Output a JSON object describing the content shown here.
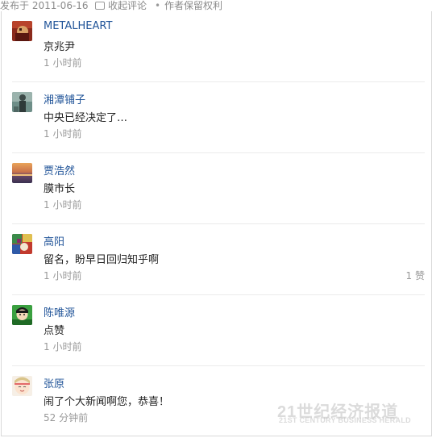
{
  "article_meta": {
    "published": "发布于 2011-06-16",
    "collapse_comments": "收起评论",
    "separator": "•",
    "copyright": "作者保留权利"
  },
  "comments": [
    {
      "author": "METALHEART",
      "text": "京兆尹",
      "time": "1 小时前",
      "likes": "",
      "avatar": "avatar-red-abstract"
    },
    {
      "author": "湘潭铺子",
      "text": "中央已经决定了…",
      "time": "1 小时前",
      "likes": "",
      "avatar": "avatar-figure-teal"
    },
    {
      "author": "贾浩然",
      "text": "膜市长",
      "time": "1 小时前",
      "likes": "",
      "avatar": "avatar-sunset"
    },
    {
      "author": "高阳",
      "text": "留名，盼早日回归知乎啊",
      "time": "1 小时前",
      "likes": "1 赞",
      "avatar": "avatar-colorful"
    },
    {
      "author": "陈唯源",
      "text": "点赞",
      "time": "1 小时前",
      "likes": "",
      "avatar": "avatar-cartoon-green"
    },
    {
      "author": "张原",
      "text": "闹了个大新闻啊您，恭喜！",
      "time": "52 分钟前",
      "likes": "",
      "avatar": "avatar-cartoon-face"
    }
  ],
  "watermark": {
    "chinese": "21世纪经济报道",
    "english": "21ST CENTURY BUSINESS HERALD"
  },
  "colors": {
    "author_link": "#225599",
    "muted_text": "#999999",
    "divider": "#ebebeb"
  }
}
